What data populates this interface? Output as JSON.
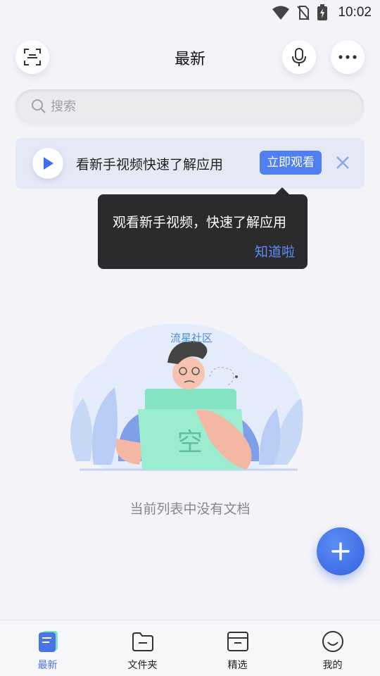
{
  "status_bar": {
    "time": "10:02",
    "icons": [
      "wifi-icon",
      "no-sim-icon",
      "battery-charging-icon"
    ]
  },
  "header": {
    "title": "最新",
    "left_icon": "scan-icon",
    "right_icons": [
      "microphone-icon",
      "more-icon"
    ]
  },
  "search": {
    "placeholder": "搜索",
    "icon": "search-icon"
  },
  "banner": {
    "text": "看新手视频快速了解应用",
    "button_label": "立即观看",
    "play_icon": "play-icon",
    "close_icon": "close-icon"
  },
  "tooltip": {
    "text": "观看新手视频，快速了解应用",
    "ack_label": "知道啦"
  },
  "empty_state": {
    "watermark": "流星社区",
    "folder_label": "空",
    "message": "当前列表中没有文档"
  },
  "fab": {
    "icon": "plus-icon"
  },
  "tabs": [
    {
      "label": "最新",
      "icon": "document-icon",
      "active": true
    },
    {
      "label": "文件夹",
      "icon": "folder-icon",
      "active": false
    },
    {
      "label": "精选",
      "icon": "archive-box-icon",
      "active": false
    },
    {
      "label": "我的",
      "icon": "smiley-icon",
      "active": false
    }
  ],
  "colors": {
    "accent": "#4f7ff0",
    "fab": "#3d6ae6",
    "tooltip_bg": "#2b2b2e",
    "banner_bg": "#e5e9f6"
  }
}
